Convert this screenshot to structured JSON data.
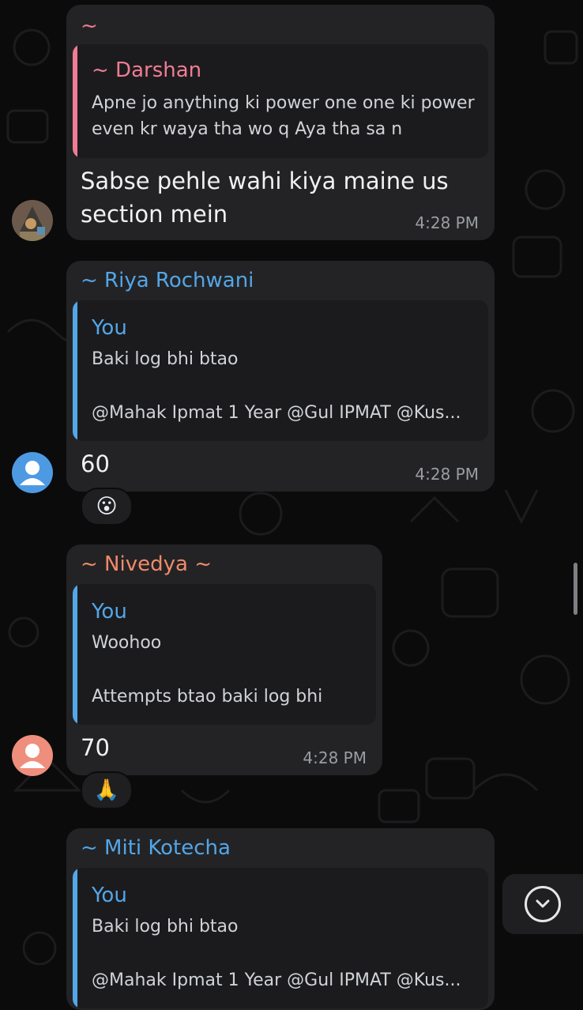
{
  "messages": [
    {
      "sender": "~",
      "sender_color": "#f07c94",
      "quote": {
        "author": "~ Darshan",
        "author_color": "#f07c94",
        "bar_color": "#f07c94",
        "lines": [
          "Apne jo anything ki power one one ki power",
          "even kr waya tha wo q Aya tha sa n"
        ]
      },
      "text_lines": [
        "Sabse pehle wahi kiya maine us",
        "section mein"
      ],
      "time": "4:28 PM"
    },
    {
      "sender": "~ Riya Rochwani",
      "sender_color": "#53a6e8",
      "quote": {
        "author": "You",
        "author_color": "#53a6e8",
        "bar_color": "#53a6e8",
        "lines": [
          "Baki log bhi btao",
          "@Mahak Ipmat 1 Year @Gul IPMAT @Kus..."
        ]
      },
      "text": "60",
      "time": "4:28 PM",
      "reaction": "😮"
    },
    {
      "sender": "~ Nivedya ~",
      "sender_color": "#f28a6a",
      "quote": {
        "author": "You",
        "author_color": "#53a6e8",
        "bar_color": "#53a6e8",
        "lines": [
          "Woohoo",
          "Attempts btao baki log bhi"
        ]
      },
      "text": "70",
      "time": "4:28 PM",
      "reaction": "🙏"
    },
    {
      "sender": "~ Miti Kotecha",
      "sender_color": "#53a6e8",
      "quote": {
        "author": "You",
        "author_color": "#53a6e8",
        "bar_color": "#53a6e8",
        "lines": [
          "Baki log bhi btao",
          "@Mahak Ipmat 1 Year @Gul IPMAT @Kus..."
        ]
      }
    }
  ],
  "icons": {
    "scroll_down": "chevron-down-circle-icon",
    "avatar_default": "person-icon"
  },
  "colors": {
    "background": "#0b0b0c",
    "bubble": "#232325",
    "quote_bg": "#1b1b1d",
    "time": "#9a9da1",
    "avatar_blue": "#4d9ae3",
    "avatar_salmon": "#ef8e7c"
  }
}
